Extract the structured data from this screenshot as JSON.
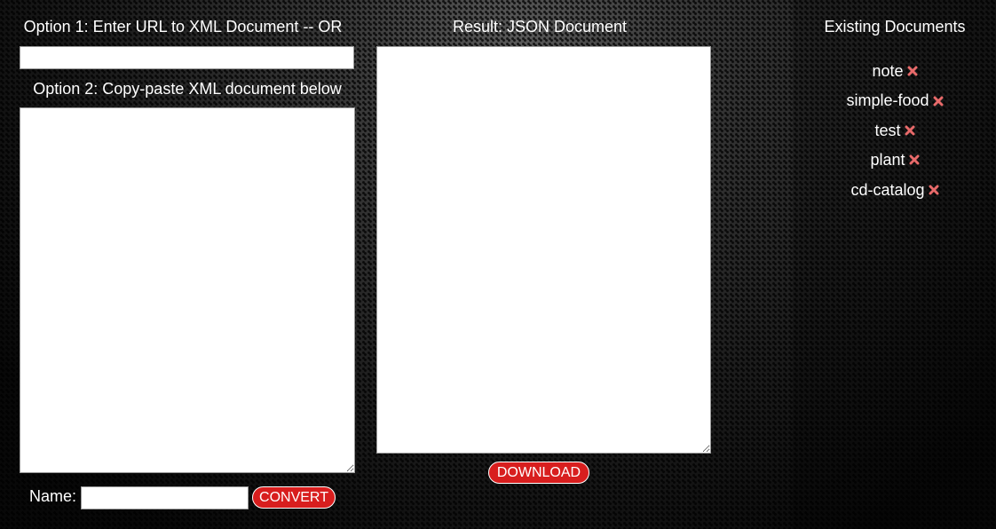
{
  "form": {
    "option1_heading": "Option 1: Enter URL to XML Document -- OR",
    "url_value": "",
    "option2_heading": "Option 2: Copy-paste XML document below",
    "xml_value": "",
    "name_label": "Name:",
    "name_value": "",
    "convert_label": "CONVERT"
  },
  "result": {
    "heading": "Result: JSON Document",
    "json_value": "",
    "download_label": "DOWNLOAD"
  },
  "sidebar": {
    "heading": "Existing Documents",
    "documents": [
      {
        "name": "note",
        "delete_icon": "x-icon"
      },
      {
        "name": "simple-food",
        "delete_icon": "x-icon"
      },
      {
        "name": "test",
        "delete_icon": "x-icon"
      },
      {
        "name": "plant",
        "delete_icon": "x-icon"
      },
      {
        "name": "cd-catalog",
        "delete_icon": "x-icon"
      }
    ]
  },
  "colors": {
    "accent_red": "#d81e1e",
    "delete_icon": "#e86a6a",
    "text": "#ffffff"
  }
}
